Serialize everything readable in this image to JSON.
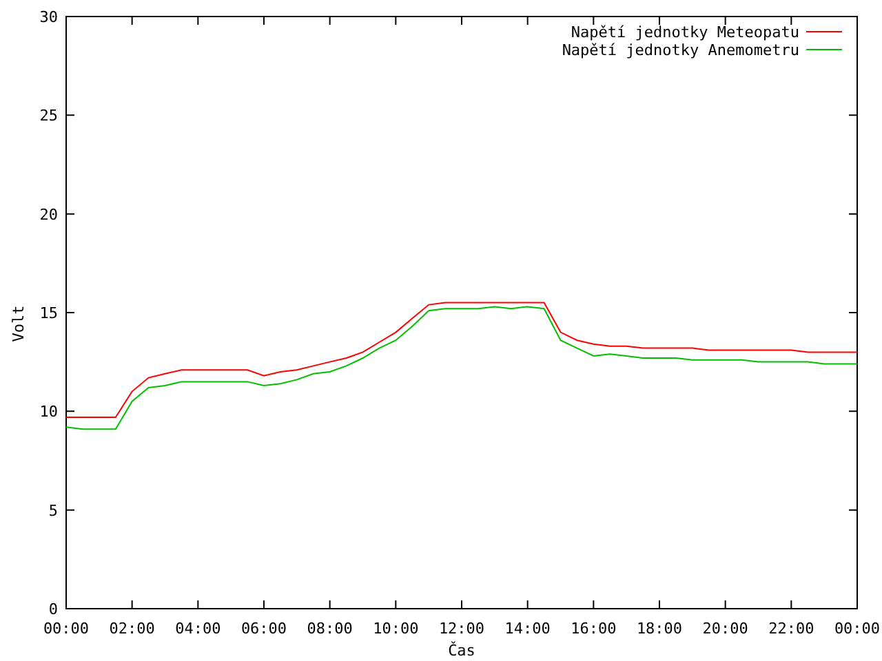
{
  "chart_data": {
    "type": "line",
    "xlabel": "Čas",
    "ylabel": "Volt",
    "x": [
      0,
      0.5,
      1,
      1.5,
      2,
      2.5,
      3,
      3.5,
      4,
      4.5,
      5,
      5.5,
      6,
      6.5,
      7,
      7.5,
      8,
      8.5,
      9,
      9.5,
      10,
      10.5,
      11,
      11.5,
      12,
      12.5,
      13,
      13.5,
      14,
      14.5,
      15,
      15.5,
      16,
      16.5,
      17,
      17.5,
      18,
      18.5,
      19,
      19.5,
      20,
      20.5,
      21,
      21.5,
      22,
      22.5,
      23,
      23.5,
      24
    ],
    "series": [
      {
        "name": "Napětí jednotky Meteopatu",
        "color": "#ff0000",
        "values": [
          9.7,
          9.7,
          9.7,
          9.7,
          11.0,
          11.7,
          11.9,
          12.1,
          12.1,
          12.1,
          12.1,
          12.1,
          11.8,
          12.0,
          12.1,
          12.3,
          12.5,
          12.7,
          13.0,
          13.5,
          14.0,
          14.7,
          15.4,
          15.5,
          15.5,
          15.5,
          15.5,
          15.5,
          15.5,
          15.5,
          14.0,
          13.6,
          13.4,
          13.3,
          13.3,
          13.2,
          13.2,
          13.2,
          13.2,
          13.1,
          13.1,
          13.1,
          13.1,
          13.1,
          13.1,
          13.0,
          13.0,
          13.0,
          13.0
        ]
      },
      {
        "name": "Napětí jednotky Anemometru",
        "color": "#00c000",
        "values": [
          9.2,
          9.1,
          9.1,
          9.1,
          10.5,
          11.2,
          11.3,
          11.5,
          11.5,
          11.5,
          11.5,
          11.5,
          11.3,
          11.4,
          11.6,
          11.9,
          12.0,
          12.3,
          12.7,
          13.2,
          13.6,
          14.3,
          15.1,
          15.2,
          15.2,
          15.2,
          15.3,
          15.2,
          15.3,
          15.2,
          13.6,
          13.2,
          12.8,
          12.9,
          12.8,
          12.7,
          12.7,
          12.7,
          12.6,
          12.6,
          12.6,
          12.6,
          12.5,
          12.5,
          12.5,
          12.5,
          12.4,
          12.4,
          12.4
        ]
      }
    ],
    "xlim": [
      0,
      24
    ],
    "ylim": [
      0,
      30
    ],
    "xticks": [
      {
        "value": 0,
        "label": "00:00"
      },
      {
        "value": 2,
        "label": "02:00"
      },
      {
        "value": 4,
        "label": "04:00"
      },
      {
        "value": 6,
        "label": "06:00"
      },
      {
        "value": 8,
        "label": "08:00"
      },
      {
        "value": 10,
        "label": "10:00"
      },
      {
        "value": 12,
        "label": "12:00"
      },
      {
        "value": 14,
        "label": "14:00"
      },
      {
        "value": 16,
        "label": "16:00"
      },
      {
        "value": 18,
        "label": "18:00"
      },
      {
        "value": 20,
        "label": "20:00"
      },
      {
        "value": 22,
        "label": "22:00"
      },
      {
        "value": 24,
        "label": "00:00"
      }
    ],
    "yticks": [
      0,
      5,
      10,
      15,
      20,
      25,
      30
    ],
    "legend": true
  }
}
